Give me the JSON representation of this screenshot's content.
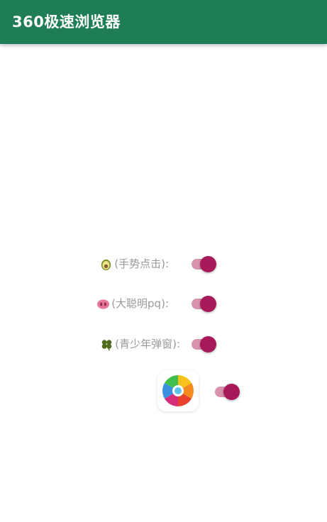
{
  "app_bar": {
    "title": "360极速浏览器",
    "color": "#1f7d55"
  },
  "settings": [
    {
      "icon": "avocado-icon",
      "label": "(手势点击):",
      "enabled": true
    },
    {
      "icon": "pig-nose-icon",
      "label": "(大聪明pq):",
      "enabled": true
    },
    {
      "icon": "clover-icon",
      "label": "(青少年弹窗):",
      "enabled": true
    }
  ],
  "browser_toggle": {
    "icon": "360-browser-logo-icon",
    "enabled": true
  },
  "colors": {
    "toggle_thumb": "#a8195a",
    "toggle_track": "#cf7fa0",
    "label_text": "#9a9a9a"
  }
}
